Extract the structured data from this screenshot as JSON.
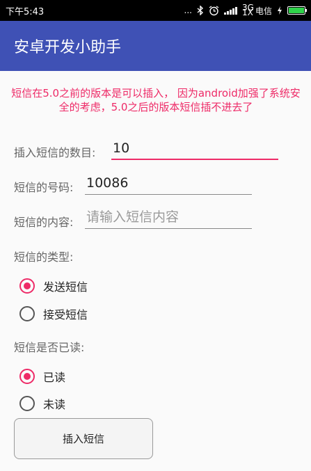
{
  "status_bar": {
    "time": "下午5:43",
    "dots": "...",
    "network": "3G 1X",
    "carrier": "电信"
  },
  "app": {
    "title": "安卓开发小助手"
  },
  "notice": "短信在5.0之前的版本是可以插入， 因为android加强了系统安全的考虑，5.0之后的版本短信插不进去了",
  "form": {
    "count_label": "插入短信的数目:",
    "count_value": "10",
    "number_label": "短信的号码:",
    "number_value": "10086",
    "content_label": "短信的内容:",
    "content_placeholder": "请输入短信内容",
    "type_label": "短信的类型:",
    "type_options": [
      "发送短信",
      "接受短信"
    ],
    "read_label": "短信是否已读:",
    "read_options": [
      "已读",
      "未读"
    ],
    "submit_label": "插入短信"
  },
  "colors": {
    "accent": "#ee2a67",
    "primary": "#3f51b5"
  },
  "icons": [
    "bluetooth-icon",
    "alarm-icon",
    "signal-icon",
    "battery-icon"
  ]
}
